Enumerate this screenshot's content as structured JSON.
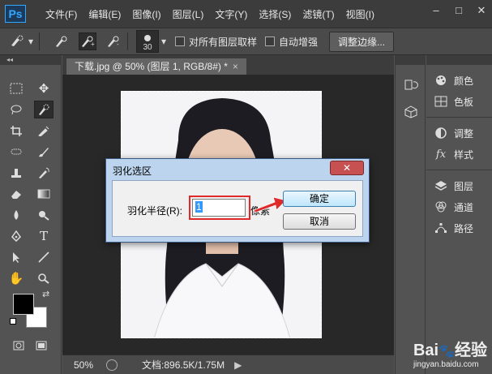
{
  "app": {
    "logo": "Ps"
  },
  "menu": [
    "文件(F)",
    "编辑(E)",
    "图像(I)",
    "图层(L)",
    "文字(Y)",
    "选择(S)",
    "滤镜(T)",
    "视图(I)"
  ],
  "window_controls": [
    "–",
    "□",
    "✕"
  ],
  "options": {
    "brush_size": "30",
    "sample_all_layers": "对所有图层取样",
    "auto_enhance": "自动增强",
    "refine_edge": "调整边缘..."
  },
  "document": {
    "tab_title": "下载.jpg @ 50% (图层 1, RGB/8#) *",
    "tab_close": "×"
  },
  "status": {
    "zoom": "50%",
    "doc_info": "文档:896.5K/1.75M",
    "arrow": "▶"
  },
  "panels": {
    "group1": [
      {
        "icon": "palette-icon",
        "label": "颜色"
      },
      {
        "icon": "swatches-icon",
        "label": "色板"
      }
    ],
    "group2": [
      {
        "icon": "adjustments-icon",
        "label": "调整"
      },
      {
        "icon": "styles-icon",
        "label": "样式"
      }
    ],
    "group3": [
      {
        "icon": "layers-icon",
        "label": "图层"
      },
      {
        "icon": "channels-icon",
        "label": "通道"
      },
      {
        "icon": "paths-icon",
        "label": "路径"
      }
    ]
  },
  "dialog": {
    "title": "羽化选区",
    "close": "✕",
    "radius_label": "羽化半径(R):",
    "radius_value": "1",
    "unit": "像素",
    "ok": "确定",
    "cancel": "取消"
  },
  "watermark": {
    "brand": "Bai",
    "brand2": "经验",
    "url": "jingyan.baidu.com"
  },
  "colors": {
    "highlight": "#e02a2a",
    "dialog_frame": "#bcd4ee",
    "selection": "#3399ff"
  }
}
